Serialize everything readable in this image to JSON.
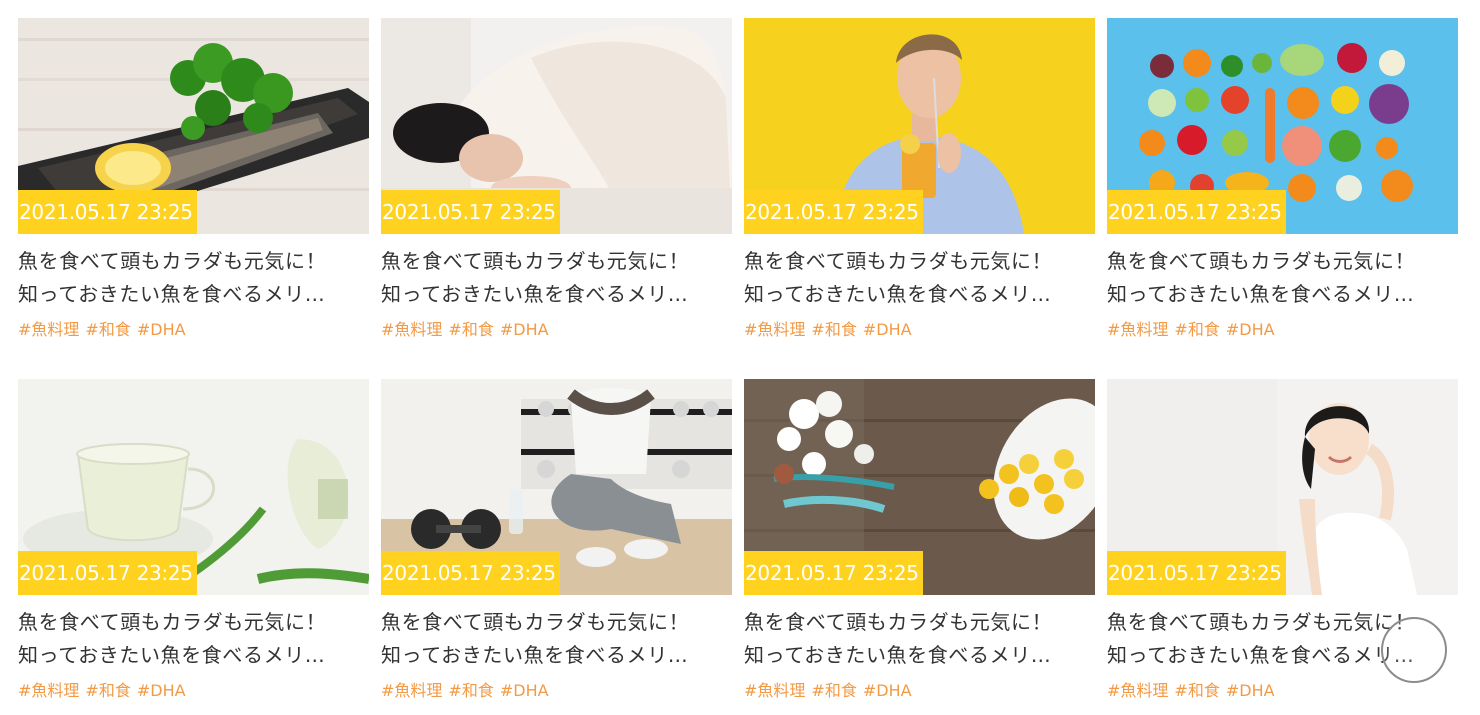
{
  "cards": [
    {
      "date": "2021.05.17 23:25",
      "title_line1": "魚を食べて頭もカラダも元気に！",
      "title_line2": "知っておきたい魚を食べるメリ…",
      "tags": [
        "#魚料理",
        "#和食",
        "#DHA"
      ],
      "image": "grilled-mackerel-parsley-lemon"
    },
    {
      "date": "2021.05.17 23:25",
      "title_line1": "魚を食べて頭もカラダも元気に！",
      "title_line2": "知っておきたい魚を食べるメリ…",
      "tags": [
        "#魚料理",
        "#和食",
        "#DHA"
      ],
      "image": "woman-sleeping-under-blanket"
    },
    {
      "date": "2021.05.17 23:25",
      "title_line1": "魚を食べて頭もカラダも元気に！",
      "title_line2": "知っておきたい魚を食べるメリ…",
      "tags": [
        "#魚料理",
        "#和食",
        "#DHA"
      ],
      "image": "man-drinking-orange-juice"
    },
    {
      "date": "2021.05.17 23:25",
      "title_line1": "魚を食べて頭もカラダも元気に！",
      "title_line2": "知っておきたい魚を食べるメリ…",
      "tags": [
        "#魚料理",
        "#和食",
        "#DHA"
      ],
      "image": "fruits-and-vegetables-flatlay"
    },
    {
      "date": "2021.05.17 23:25",
      "title_line1": "魚を食べて頭もカラダも元気に！",
      "title_line2": "知っておきたい魚を食べるメリ…",
      "tags": [
        "#魚料理",
        "#和食",
        "#DHA"
      ],
      "image": "herbal-tea-glass-cup"
    },
    {
      "date": "2021.05.17 23:25",
      "title_line1": "魚を食べて頭もカラダも元気に！",
      "title_line2": "知っておきたい魚を食べるメリ…",
      "tags": [
        "#魚料理",
        "#和食",
        "#DHA"
      ],
      "image": "woman-resting-after-workout"
    },
    {
      "date": "2021.05.17 23:25",
      "title_line1": "魚を食べて頭もカラダも元気に！",
      "title_line2": "知っておきたい魚を食べるメリ…",
      "tags": [
        "#魚料理",
        "#和食",
        "#DHA"
      ],
      "image": "fish-oil-capsules-on-wood"
    },
    {
      "date": "2021.05.17 23:25",
      "title_line1": "魚を食べて頭もカラダも元気に！",
      "title_line2": "知っておきたい魚を食べるメリ…",
      "tags": [
        "#魚料理",
        "#和食",
        "#DHA"
      ],
      "image": "smiling-woman-skin-care"
    }
  ],
  "colors": {
    "date_badge": "#ffd21f",
    "tag_text": "#f39a45",
    "title_text": "#333333"
  },
  "scroll_top": {
    "icon": "scroll-to-top-icon"
  }
}
